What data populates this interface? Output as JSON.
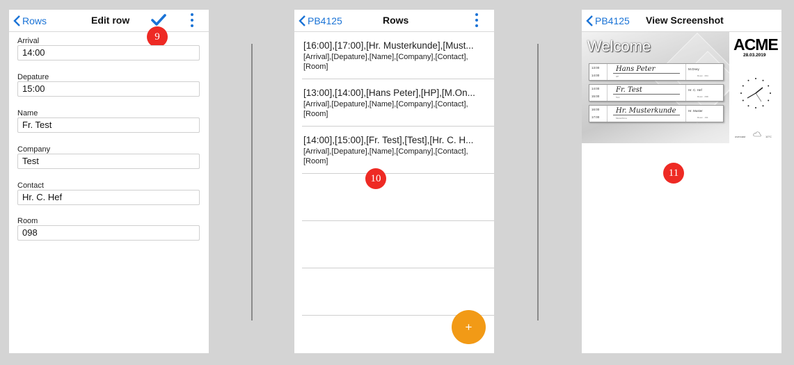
{
  "screen1": {
    "back_label": "Rows",
    "title": "Edit row",
    "badge": "9",
    "fields": [
      {
        "label": "Arrival",
        "value": "14:00"
      },
      {
        "label": "Depature",
        "value": "15:00"
      },
      {
        "label": "Name",
        "value": "Fr. Test"
      },
      {
        "label": "Company",
        "value": "Test"
      },
      {
        "label": "Contact",
        "value": "Hr. C. Hef"
      },
      {
        "label": "Room",
        "value": "098"
      }
    ]
  },
  "screen2": {
    "back_label": "PB4125",
    "title": "Rows",
    "badge": "10",
    "rows": [
      {
        "title": "[16:00],[17:00],[Hr. Musterkunde],[Must...",
        "subtitle": "[Arrival],[Depature],[Name],[Company],[Contact],[Room]"
      },
      {
        "title": "[13:00],[14:00],[Hans Peter],[HP],[M.On...",
        "subtitle": "[Arrival],[Depature],[Name],[Company],[Contact],[Room]"
      },
      {
        "title": "[14:00],[15:00],[Fr. Test],[Test],[Hr. C. H...",
        "subtitle": "[Arrival],[Depature],[Name],[Company],[Contact],[Room]"
      }
    ],
    "fab_label": "+"
  },
  "screen3": {
    "back_label": "PB4125",
    "title": "View Screenshot",
    "badge": "11",
    "preview": {
      "welcome": "Welcome",
      "logo": "ACME",
      "date": "28.03.2019",
      "cards": [
        {
          "arrival": "13:00",
          "departure": "14:00",
          "name": "Hans Peter",
          "company": "HP",
          "contact": "M.Oney",
          "room": "Room · 064"
        },
        {
          "arrival": "14:00",
          "departure": "15:00",
          "name": "Fr. Test",
          "company": "Test",
          "contact": "Hr. C. Hef",
          "room": "Room · 098"
        },
        {
          "arrival": "16:00",
          "departure": "17:00",
          "name": "Hr. Musterkunde",
          "company": "Musterfirma",
          "contact": "Hr. Muster",
          "room": "Room · 191"
        }
      ],
      "weather": {
        "left": "overcast",
        "right": "10°C"
      }
    }
  },
  "colors": {
    "accent": "#1a73d6",
    "badge": "#ee2a24",
    "fab": "#f29a16",
    "background": "#d4d4d4"
  }
}
